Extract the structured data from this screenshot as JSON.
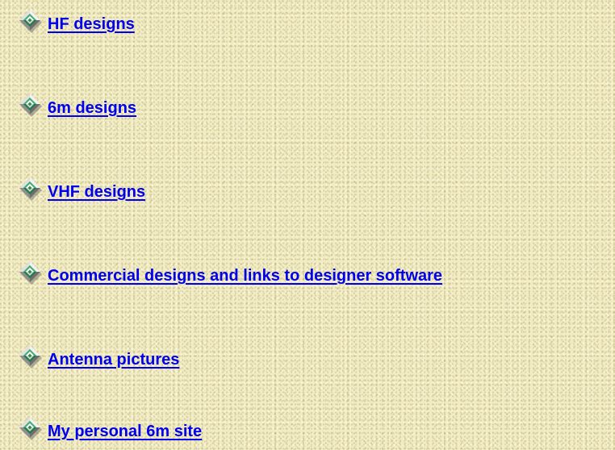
{
  "colors": {
    "link": "#0000ee",
    "background": "#f1ecc4",
    "bullet_green": "#2e8b57",
    "bullet_gray": "#c0c0c0"
  },
  "links": [
    {
      "label": "HF designs",
      "icon": "diamond-bullet-icon"
    },
    {
      "label": "6m designs",
      "icon": "diamond-bullet-icon"
    },
    {
      "label": "VHF designs",
      "icon": "diamond-bullet-icon"
    },
    {
      "label": "Commercial designs and links to designer software",
      "icon": "diamond-bullet-icon"
    },
    {
      "label": "Antenna pictures",
      "icon": "diamond-bullet-icon"
    },
    {
      "label": "My personal 6m site",
      "icon": "diamond-bullet-icon"
    }
  ]
}
